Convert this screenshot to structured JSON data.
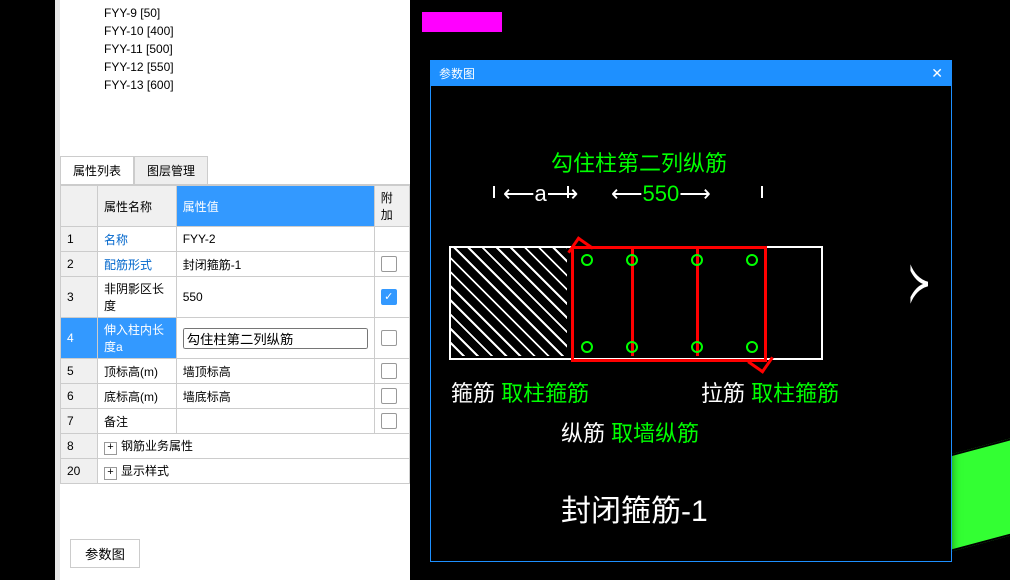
{
  "tree": [
    "FYY-9 [50]",
    "FYY-10 [400]",
    "FYY-11 [500]",
    "FYY-12 [550]",
    "FYY-13 [600]"
  ],
  "tabs": {
    "prop": "属性列表",
    "layer": "图层管理"
  },
  "headers": {
    "name": "属性名称",
    "value": "属性值",
    "extra": "附加"
  },
  "rows": {
    "r1": {
      "n": "1",
      "name": "名称",
      "val": "FYY-2"
    },
    "r2": {
      "n": "2",
      "name": "配筋形式",
      "val": "封闭箍筋-1"
    },
    "r3": {
      "n": "3",
      "name": "非阴影区长度",
      "val": "550"
    },
    "r4": {
      "n": "4",
      "name": "伸入柱内长度a",
      "val": "勾住柱第二列纵筋"
    },
    "r5": {
      "n": "5",
      "name": "顶标高(m)",
      "val": "墙顶标高"
    },
    "r6": {
      "n": "6",
      "name": "底标高(m)",
      "val": "墙底标高"
    },
    "r7": {
      "n": "7",
      "name": "备注",
      "val": ""
    },
    "r8": {
      "n": "8",
      "name": "钢筋业务属性"
    },
    "r20": {
      "n": "20",
      "name": "显示样式"
    }
  },
  "param_btn": "参数图",
  "popup_title": "参数图",
  "dia": {
    "top": "勾住柱第二列纵筋",
    "a": "a",
    "len": "550",
    "gj": "箍筋",
    "gj2": "取柱箍筋",
    "lj": "拉筋",
    "lj2": "取柱箍筋",
    "zj": "纵筋",
    "zj2": "取墙纵筋",
    "title": "封闭箍筋-1"
  }
}
